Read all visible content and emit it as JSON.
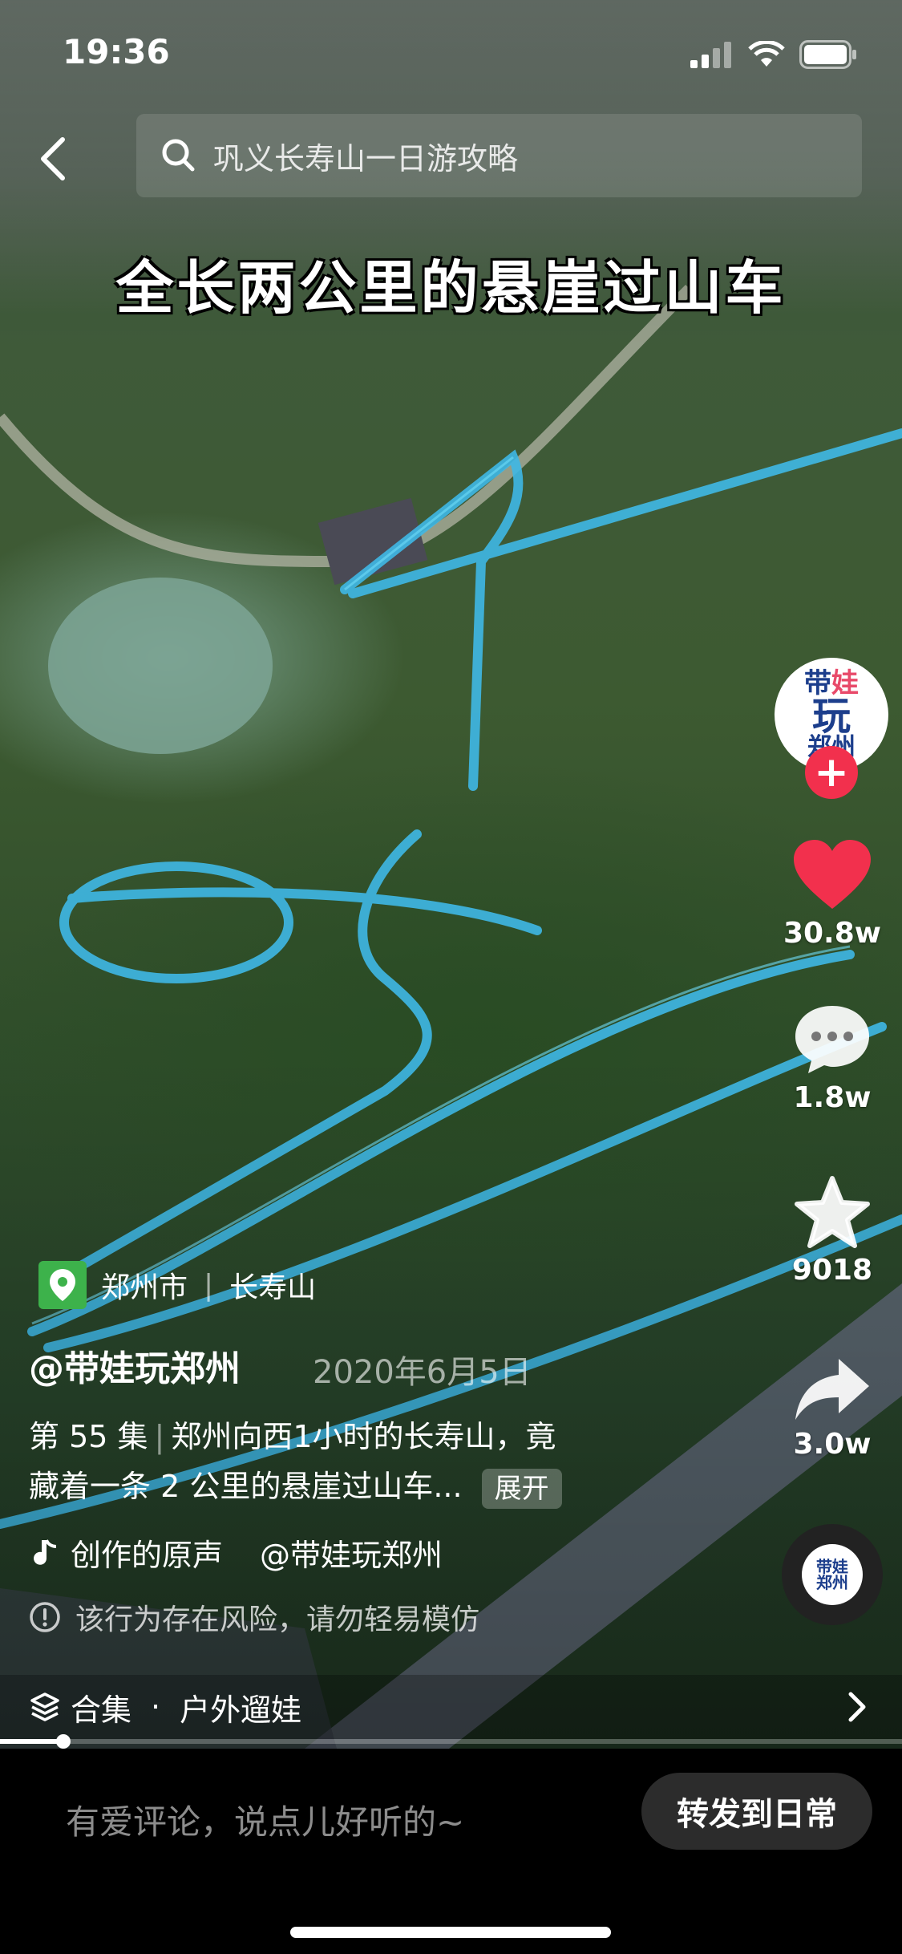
{
  "status": {
    "time": "19:36"
  },
  "header": {
    "search_query": "巩义长寿山一日游攻略"
  },
  "video": {
    "caption": "全长两公里的悬崖过山车",
    "progress": 0.07
  },
  "sidebar": {
    "avatar_text": [
      "带",
      "娃",
      "玩",
      "郑州"
    ],
    "likes": "30.8w",
    "comments": "1.8w",
    "favorites": "9018",
    "shares": "3.0w",
    "music_disc_text": [
      "带娃",
      "郑州"
    ]
  },
  "info": {
    "location_city": "郑州市",
    "location_place": "长寿山",
    "author": "@带娃玩郑州",
    "date": "2020年6月5日",
    "episode": "第 55 集",
    "desc_line1": "郑州向西1小时的长寿山，竟",
    "desc_line2": "藏着一条 2 公里的悬崖过山车...",
    "expand_label": "展开",
    "music_title": "创作的原声",
    "music_author": "@带娃玩郑州",
    "warning": "该行为存在风险，请勿轻易模仿"
  },
  "collection": {
    "label": "合集",
    "separator": "·",
    "name": "户外遛娃"
  },
  "bottom": {
    "comment_placeholder": "有爱评论，说点儿好听的~",
    "share_label": "转发到日常"
  },
  "colors": {
    "like": "#f2304d",
    "location_tag": "#3db24b",
    "track": "#3fb8e6"
  }
}
